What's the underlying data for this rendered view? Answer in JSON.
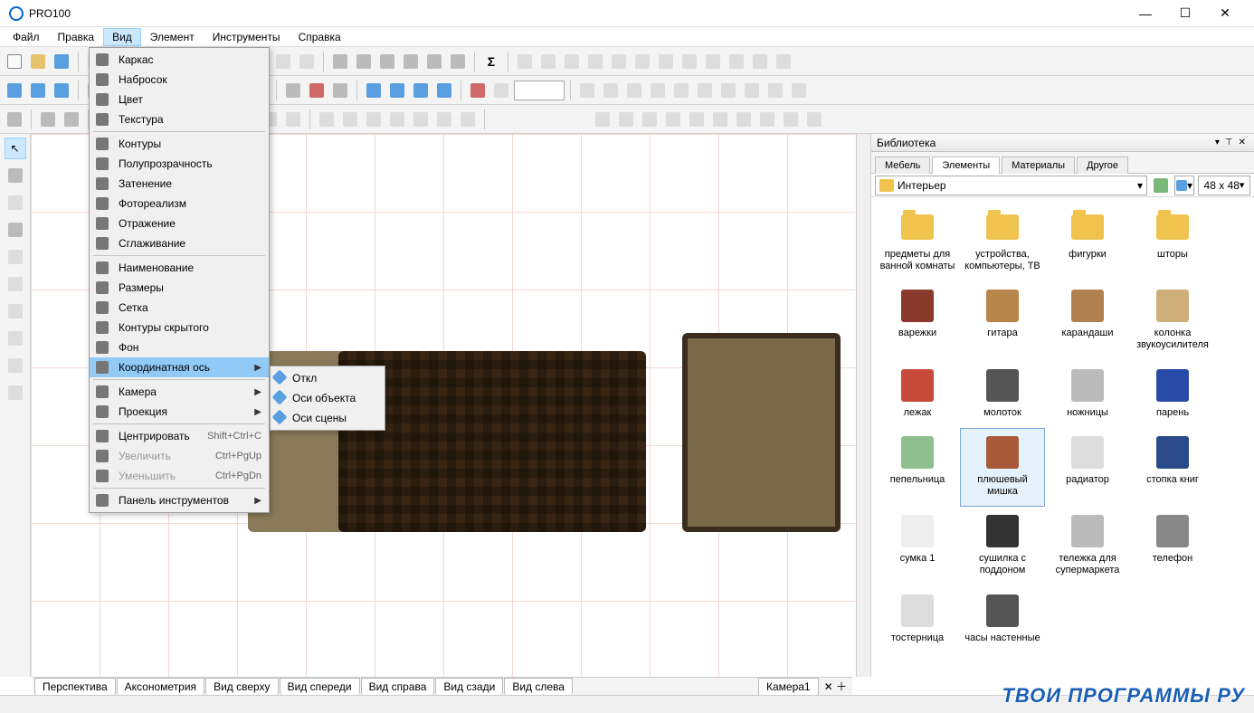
{
  "window": {
    "title": "PRO100"
  },
  "menubar": [
    "Файл",
    "Правка",
    "Вид",
    "Элемент",
    "Инструменты",
    "Справка"
  ],
  "menubar_active": "Вид",
  "view_menu": {
    "groups": [
      [
        {
          "icon": "wireframe",
          "label": "Каркас"
        },
        {
          "icon": "sketch",
          "label": "Набросок"
        },
        {
          "icon": "color",
          "label": "Цвет"
        },
        {
          "icon": "texture",
          "label": "Текстура"
        }
      ],
      [
        {
          "icon": "contours",
          "label": "Контуры"
        },
        {
          "icon": "transparent",
          "label": "Полупрозрачность"
        },
        {
          "icon": "shading",
          "label": "Затенение"
        },
        {
          "icon": "photoreal",
          "label": "Фотореализм"
        },
        {
          "icon": "reflection",
          "label": "Отражение"
        },
        {
          "icon": "smoothing",
          "label": "Сглаживение",
          "actual": "Сглаживание"
        }
      ],
      [
        {
          "icon": "naming",
          "label": "Наименование"
        },
        {
          "icon": "dims",
          "label": "Размеры"
        },
        {
          "icon": "grid",
          "label": "Сетка"
        },
        {
          "icon": "hidden",
          "label": "Контуры скрытого"
        },
        {
          "icon": "bg",
          "label": "Фон"
        },
        {
          "icon": "axis",
          "label": "Координатная ось",
          "submenu": true,
          "highlight": true
        }
      ],
      [
        {
          "icon": "camera",
          "label": "Камера",
          "submenu": true
        },
        {
          "icon": "proj",
          "label": "Проекция",
          "submenu": true
        }
      ],
      [
        {
          "icon": "center",
          "label": "Центрировать",
          "shortcut": "Shift+Ctrl+C"
        },
        {
          "icon": "zoomin",
          "label": "Увеличить",
          "shortcut": "Ctrl+PgUp",
          "disabled": true
        },
        {
          "icon": "zoomout",
          "label": "Уменьшить",
          "shortcut": "Ctrl+PgDn",
          "disabled": true
        }
      ],
      [
        {
          "icon": "panels",
          "label": "Панель инструментов",
          "submenu": true
        }
      ]
    ]
  },
  "axis_submenu": [
    {
      "icon": "off",
      "label": "Откл"
    },
    {
      "icon": "obj",
      "label": "Оси объекта"
    },
    {
      "icon": "scene",
      "label": "Оси сцены"
    }
  ],
  "library": {
    "title": "Библиотека",
    "tabs": [
      "Мебель",
      "Элементы",
      "Материалы",
      "Другое"
    ],
    "active_tab": "Элементы",
    "path": "Интерьер",
    "thumb_size": "48 x  48",
    "items": [
      {
        "type": "folder",
        "label": "предметы для ванной комнаты"
      },
      {
        "type": "folder",
        "label": "устройства, компьютеры, ТВ"
      },
      {
        "type": "folder",
        "label": "фигурки"
      },
      {
        "type": "folder",
        "label": "шторы"
      },
      {
        "type": "obj",
        "label": "варежки",
        "color": "#8a3a2a"
      },
      {
        "type": "obj",
        "label": "гитара",
        "color": "#b8864a"
      },
      {
        "type": "obj",
        "label": "карандаши",
        "color": "#b08050"
      },
      {
        "type": "obj",
        "label": "колонка звукоусилителя",
        "color": "#cfae7a"
      },
      {
        "type": "obj",
        "label": "лежак",
        "color": "#c74a3a"
      },
      {
        "type": "obj",
        "label": "молоток",
        "color": "#555"
      },
      {
        "type": "obj",
        "label": "ножницы",
        "color": "#bbb"
      },
      {
        "type": "obj",
        "label": "парень",
        "color": "#2a4aa8"
      },
      {
        "type": "obj",
        "label": "пепельница",
        "color": "#8fbf8f"
      },
      {
        "type": "obj",
        "label": "плюшевый мишка",
        "color": "#a85a3a",
        "selected": true
      },
      {
        "type": "obj",
        "label": "радиатор",
        "color": "#ddd"
      },
      {
        "type": "obj",
        "label": "стопка книг",
        "color": "#2a4a8a"
      },
      {
        "type": "obj",
        "label": "сумка 1",
        "color": "#eee"
      },
      {
        "type": "obj",
        "label": "сушилка с поддоном",
        "color": "#333"
      },
      {
        "type": "obj",
        "label": "тележка для супермаркета",
        "color": "#bbb"
      },
      {
        "type": "obj",
        "label": "телефон",
        "color": "#888"
      },
      {
        "type": "obj",
        "label": "тостерница",
        "color": "#ddd"
      },
      {
        "type": "obj",
        "label": "часы настенные",
        "color": "#555"
      }
    ]
  },
  "view_tabs": [
    "Перспектива",
    "Аксонометрия",
    "Вид сверху",
    "Вид спереди",
    "Вид справа",
    "Вид сзади",
    "Вид слева"
  ],
  "camera_tab": "Камера1",
  "watermark": "ТВОИ ПРОГРАММЫ РУ"
}
